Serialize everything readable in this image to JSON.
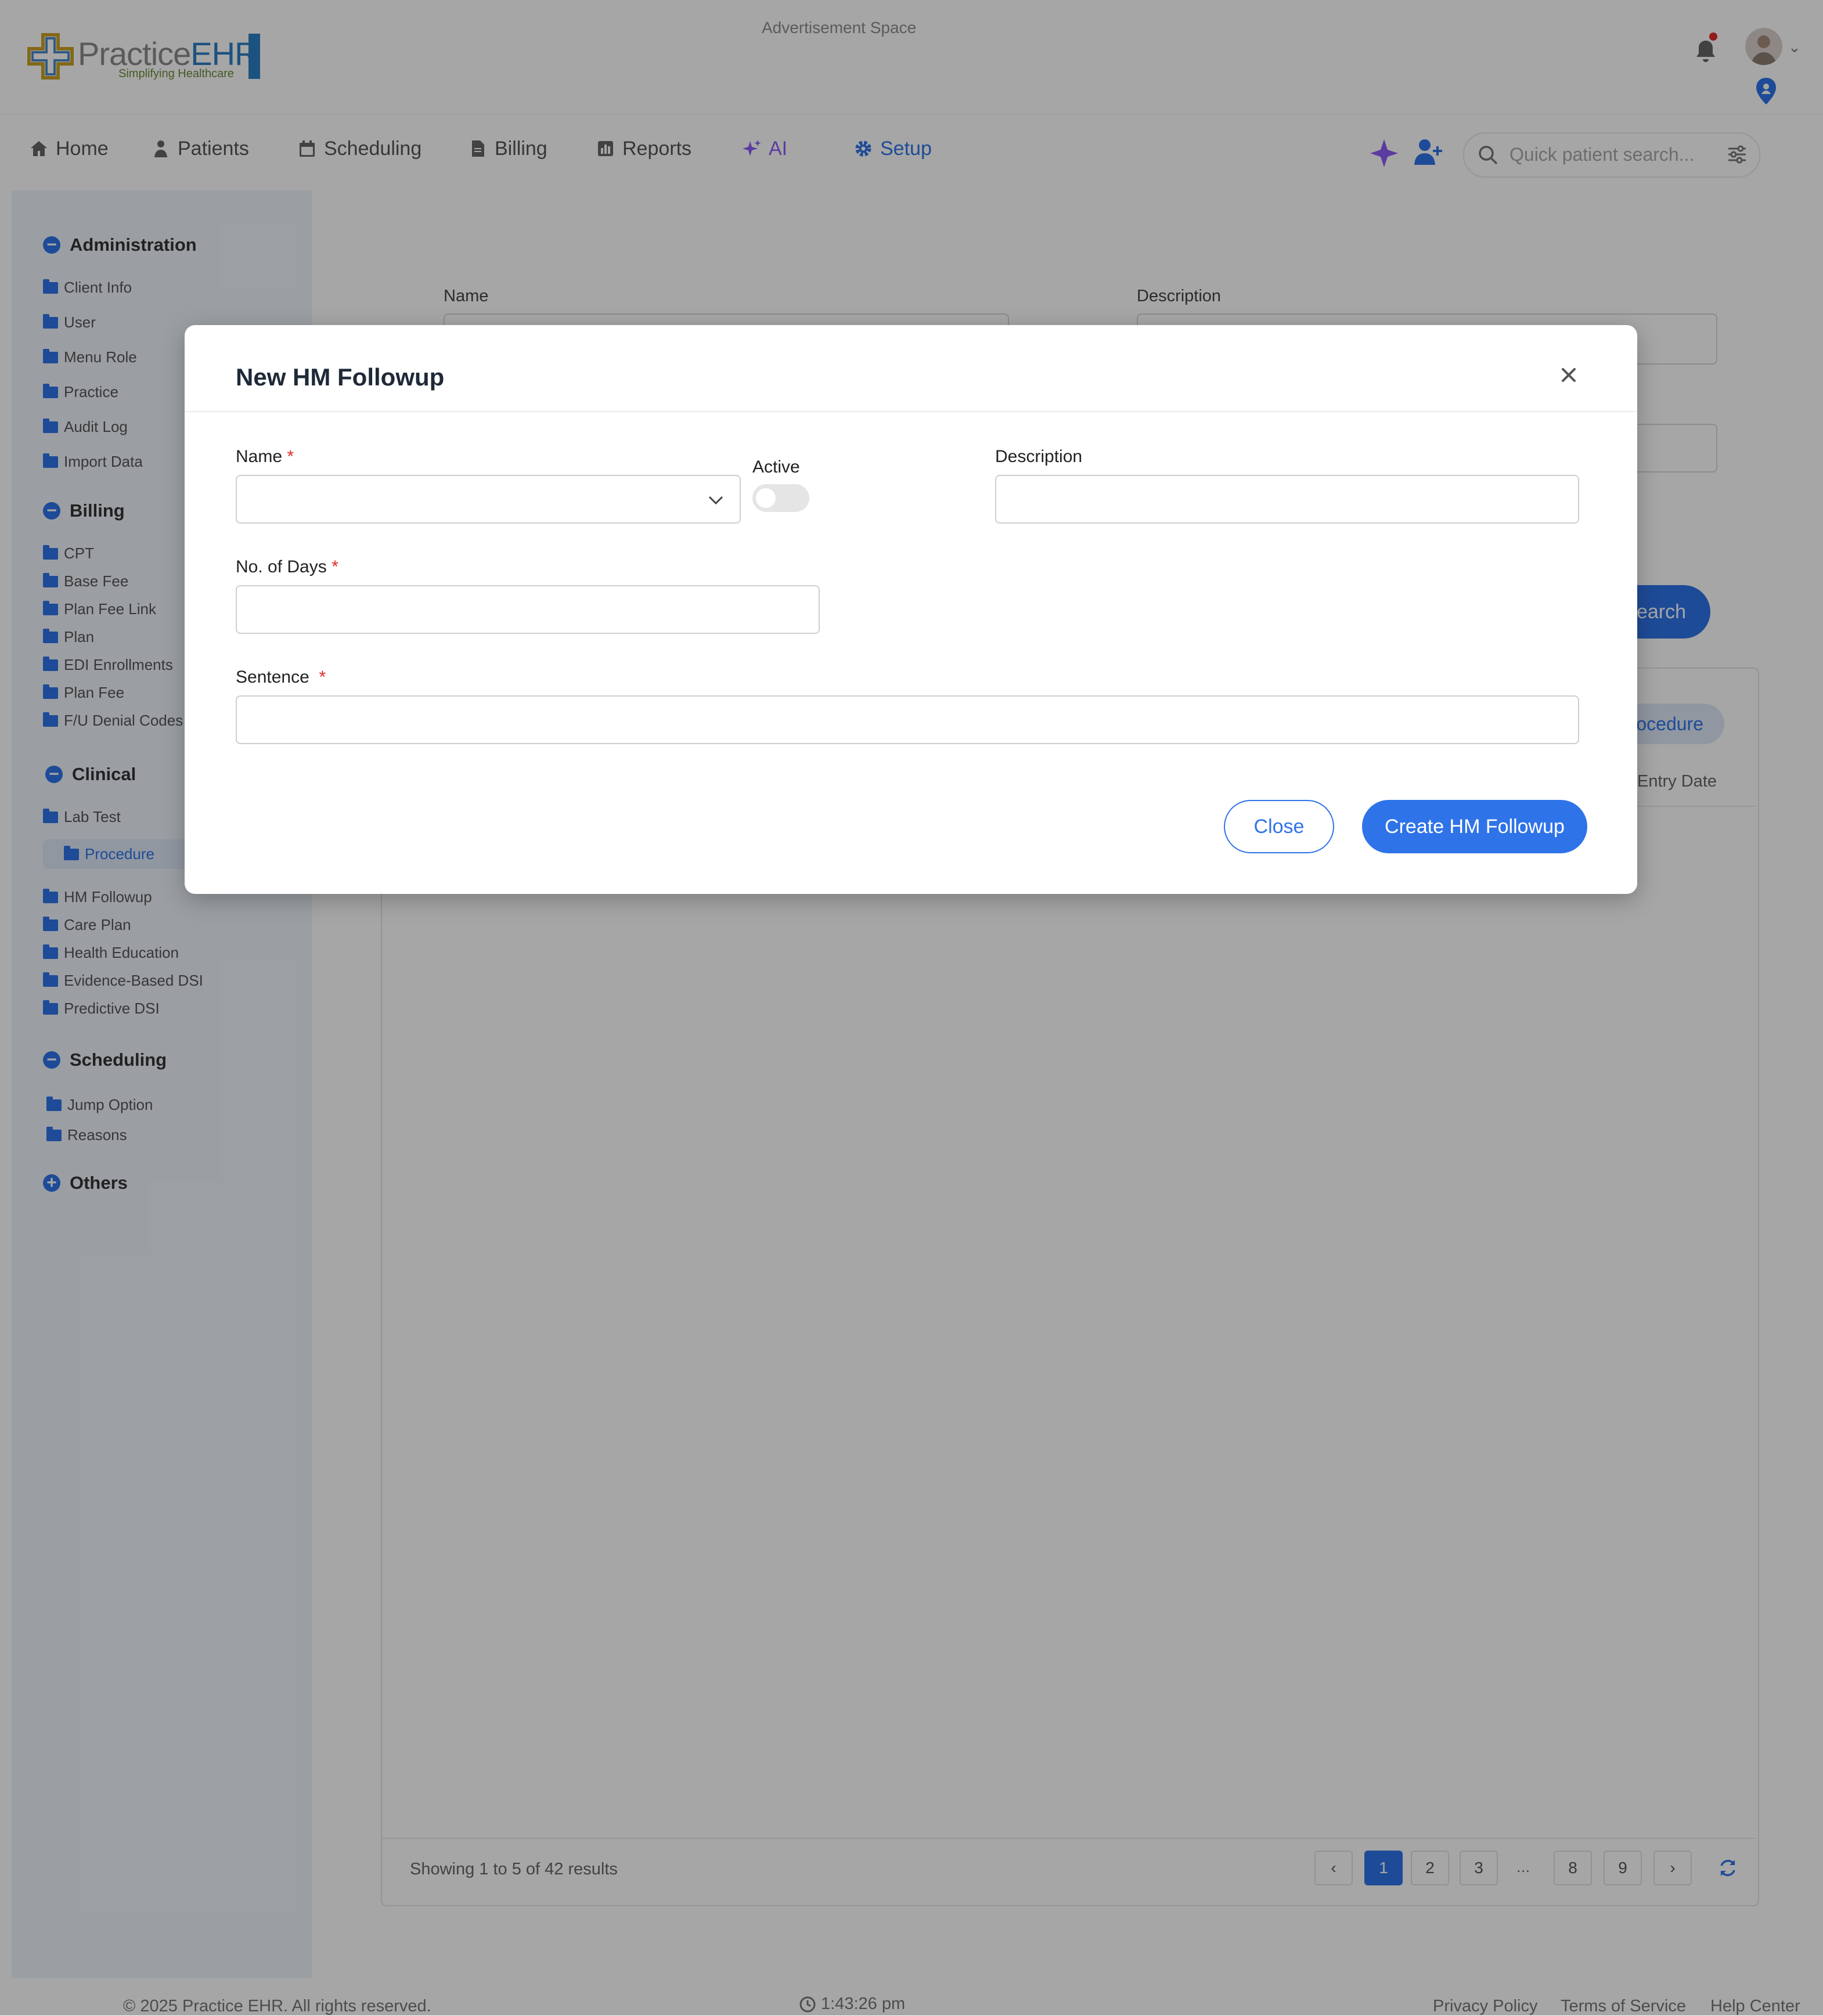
{
  "header": {
    "logo": {
      "brand_main": "Practice",
      "brand_accent": "EHR",
      "tagline": "Simplifying Healthcare"
    },
    "ad_text": "Advertisement Space"
  },
  "nav": {
    "items": [
      {
        "label": "Home",
        "icon": "home-icon"
      },
      {
        "label": "Patients",
        "icon": "patient-icon"
      },
      {
        "label": "Scheduling",
        "icon": "calendar-icon"
      },
      {
        "label": "Billing",
        "icon": "invoice-icon"
      },
      {
        "label": "Reports",
        "icon": "chart-icon"
      },
      {
        "label": "AI",
        "icon": "sparkle-icon"
      },
      {
        "label": "Setup",
        "icon": "gear-icon"
      }
    ],
    "active": "Setup",
    "search_placeholder": "Quick patient search..."
  },
  "sidebar": {
    "sections": [
      {
        "title": "Administration",
        "expanded": true,
        "items": [
          "Client Info",
          "User",
          "Menu Role",
          "Practice",
          "Audit Log",
          "Import Data"
        ]
      },
      {
        "title": "Billing",
        "expanded": true,
        "items": [
          "CPT",
          "Base Fee",
          "Plan Fee Link",
          "Plan",
          "EDI Enrollments",
          "Plan Fee",
          "F/U Denial Codes"
        ]
      },
      {
        "title": "Clinical",
        "expanded": true,
        "items": [
          "Lab Test",
          "Procedure",
          "HM Followup",
          "Care Plan",
          "Health Education",
          "Evidence-Based DSI",
          "Predictive DSI"
        ]
      },
      {
        "title": "Scheduling",
        "expanded": true,
        "items": [
          "Jump Option",
          "Reasons"
        ]
      },
      {
        "title": "Others",
        "expanded": false,
        "items": []
      }
    ],
    "active_item": "Procedure"
  },
  "main": {
    "filter_name_label": "Name",
    "filter_description_label": "Description",
    "search_button": "Search",
    "add_button": "+ Procedure",
    "column_entry_date": "Entry Date",
    "showing_text": "Showing 1 to 5 of 42 results",
    "pagination": {
      "pages": [
        "1",
        "2",
        "3",
        "8",
        "9"
      ],
      "current": "1",
      "ellipsis": "..."
    }
  },
  "footer": {
    "copyright": "© 2025 Practice EHR. All rights reserved.",
    "time": "1:43:26 pm",
    "links": [
      "Privacy Policy",
      "Terms of Service",
      "Help Center"
    ]
  },
  "modal": {
    "title": "New HM Followup",
    "name_label": "Name",
    "active_label": "Active",
    "active_value": false,
    "description_label": "Description",
    "days_label": "No. of Days",
    "sentence_label": "Sentence",
    "required_mark": "*",
    "name_value": "",
    "description_value": "",
    "days_value": "",
    "sentence_value": "",
    "close_button": "Close",
    "create_button": "Create HM Followup"
  },
  "colors": {
    "primary": "#2f73e8",
    "ai": "#8b5cf6",
    "required": "#e02a2a",
    "sidebar_bg": "#eff4fb"
  }
}
